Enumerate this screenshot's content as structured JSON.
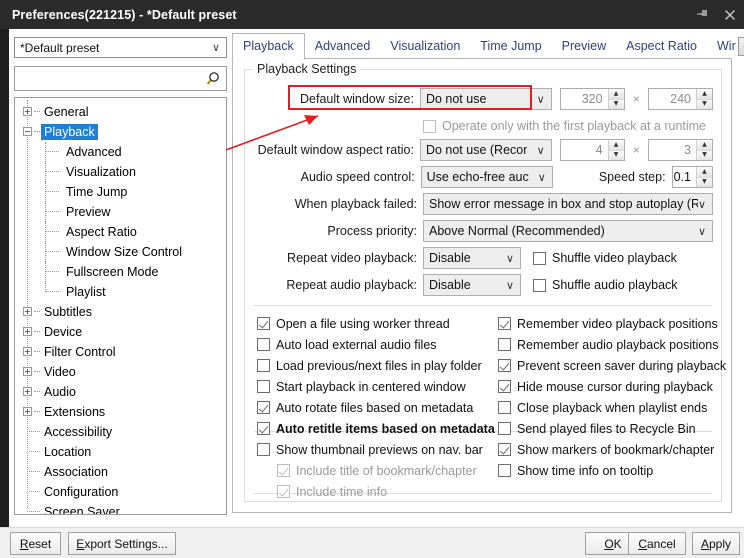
{
  "titlebar": {
    "title": "Preferences(221215) - *Default preset",
    "pin_icon": "pin-icon",
    "close_icon": "close-icon"
  },
  "sidebar": {
    "preset": {
      "value": "*Default preset",
      "arrow": "∨"
    },
    "search": {
      "value": "",
      "placeholder": "",
      "icon": "search-icon"
    },
    "tree": [
      {
        "label": "General",
        "level": 0,
        "expander": "plus"
      },
      {
        "label": "Playback",
        "level": 0,
        "expander": "minus",
        "selected": true
      },
      {
        "label": "Advanced",
        "level": 1
      },
      {
        "label": "Visualization",
        "level": 1
      },
      {
        "label": "Time Jump",
        "level": 1
      },
      {
        "label": "Preview",
        "level": 1
      },
      {
        "label": "Aspect Ratio",
        "level": 1
      },
      {
        "label": "Window Size Control",
        "level": 1
      },
      {
        "label": "Fullscreen Mode",
        "level": 1
      },
      {
        "label": "Playlist",
        "level": 1
      },
      {
        "label": "Subtitles",
        "level": 0,
        "expander": "plus"
      },
      {
        "label": "Device",
        "level": 0,
        "expander": "plus"
      },
      {
        "label": "Filter Control",
        "level": 0,
        "expander": "plus"
      },
      {
        "label": "Video",
        "level": 0,
        "expander": "plus"
      },
      {
        "label": "Audio",
        "level": 0,
        "expander": "plus"
      },
      {
        "label": "Extensions",
        "level": 0,
        "expander": "plus"
      },
      {
        "label": "Accessibility",
        "level": 0
      },
      {
        "label": "Location",
        "level": 0
      },
      {
        "label": "Association",
        "level": 0
      },
      {
        "label": "Configuration",
        "level": 0
      },
      {
        "label": "Screen Saver",
        "level": 0
      }
    ]
  },
  "tabs": {
    "items": [
      {
        "label": "Playback",
        "active": true
      },
      {
        "label": "Advanced",
        "active": false
      },
      {
        "label": "Visualization",
        "active": false
      },
      {
        "label": "Time Jump",
        "active": false
      },
      {
        "label": "Preview",
        "active": false
      },
      {
        "label": "Aspect Ratio",
        "active": false
      },
      {
        "label": "Wir",
        "active": false
      }
    ],
    "scroll_left": "◄",
    "scroll_right": "►"
  },
  "playback_settings": {
    "group_title": "Playback Settings",
    "default_window_size": {
      "label": "Default window size:",
      "value": "Do not use",
      "arrow": "∨",
      "width": "320",
      "height": "240",
      "separator": "×",
      "disabled": true
    },
    "operate_first_playback": {
      "label": "Operate only with the first playback at a runtime",
      "checked": false,
      "disabled": true
    },
    "default_window_aspect_ratio": {
      "label": "Default window aspect ratio:",
      "value": "Do not use (Recor",
      "arrow": "∨",
      "width": "4",
      "height": "3",
      "separator": "×",
      "disabled": true
    },
    "audio_speed_control": {
      "label": "Audio speed control:",
      "value": "Use echo-free auc",
      "arrow": "∨"
    },
    "speed_step": {
      "label": "Speed step:",
      "value": "0.1"
    },
    "when_playback_failed": {
      "label": "When playback failed:",
      "value": "Show error message in box and stop autoplay (Recor",
      "arrow": "∨"
    },
    "process_priority": {
      "label": "Process priority:",
      "value": "Above Normal (Recommended)",
      "arrow": "∨"
    },
    "repeat_video_playback": {
      "label": "Repeat video playback:",
      "value": "Disable",
      "arrow": "∨"
    },
    "shuffle_video_playback": {
      "label": "Shuffle video playback",
      "checked": false
    },
    "repeat_audio_playback": {
      "label": "Repeat audio playback:",
      "value": "Disable",
      "arrow": "∨"
    },
    "shuffle_audio_playback": {
      "label": "Shuffle audio playback",
      "checked": false
    },
    "checkboxes_left": [
      {
        "label": "Open a file using worker thread",
        "checked": true,
        "disabled": false,
        "bold": false
      },
      {
        "label": "Auto load external audio files",
        "checked": false,
        "disabled": false,
        "bold": false
      },
      {
        "label": "Load previous/next files in play folder",
        "checked": false,
        "disabled": false,
        "bold": false
      },
      {
        "label": "Start playback in centered window",
        "checked": false,
        "disabled": false,
        "bold": false
      },
      {
        "label": "Auto rotate files based on metadata",
        "checked": true,
        "disabled": false,
        "bold": false
      },
      {
        "label": "Auto retitle items based on metadata",
        "checked": true,
        "disabled": false,
        "bold": true
      }
    ],
    "checkboxes_right": [
      {
        "label": "Remember video playback positions",
        "checked": true,
        "disabled": false,
        "bold": false
      },
      {
        "label": "Remember audio playback positions",
        "checked": false,
        "disabled": false,
        "bold": false
      },
      {
        "label": "Prevent screen saver during playback",
        "checked": true,
        "disabled": false,
        "bold": false
      },
      {
        "label": "Hide mouse cursor during playback",
        "checked": true,
        "disabled": false,
        "bold": false
      },
      {
        "label": "Close playback when playlist ends",
        "checked": false,
        "disabled": false,
        "bold": false
      },
      {
        "label": "Send played files to Recycle Bin",
        "checked": false,
        "disabled": false,
        "bold": false
      }
    ],
    "thumbnail_left": [
      {
        "label": "Show thumbnail previews on nav. bar",
        "checked": false,
        "disabled": false,
        "indent": 0
      },
      {
        "label": "Include title of bookmark/chapter",
        "checked": true,
        "disabled": true,
        "indent": 1
      },
      {
        "label": "Include time info",
        "checked": true,
        "disabled": true,
        "indent": 1
      }
    ],
    "thumbnail_right": [
      {
        "label": "Show markers of bookmark/chapter",
        "checked": true,
        "disabled": false
      },
      {
        "label": "Show time info on tooltip",
        "checked": false,
        "disabled": false
      }
    ]
  },
  "footer": {
    "reset": {
      "pre": "",
      "accel": "R",
      "post": "eset"
    },
    "export": {
      "pre": "",
      "accel": "E",
      "post": "xport Settings..."
    },
    "ok": {
      "pre": "",
      "accel": "O",
      "post": "K"
    },
    "cancel": {
      "pre": "",
      "accel": "C",
      "post": "ancel"
    },
    "apply": {
      "pre": "",
      "accel": "A",
      "post": "pply"
    }
  },
  "annotation": {
    "highlight_color": "#e02020",
    "arrow_color": "#e02020"
  }
}
